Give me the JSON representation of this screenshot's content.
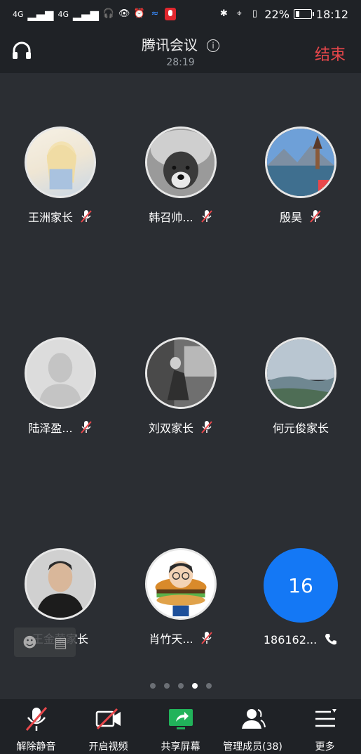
{
  "status_bar": {
    "signal1": "4G",
    "signal2": "4G",
    "battery": "22%",
    "time": "18:12"
  },
  "header": {
    "title": "腾讯会议",
    "timer": "28:19",
    "end_label": "结束"
  },
  "participants": [
    {
      "name": "王洲家长",
      "muted": true,
      "avatar": "anime-girl"
    },
    {
      "name": "韩召帅...",
      "muted": true,
      "avatar": "dog"
    },
    {
      "name": "殷昊",
      "muted": true,
      "avatar": "landscape"
    },
    {
      "name": "陆泽盈...",
      "muted": true,
      "avatar": "default-person"
    },
    {
      "name": "刘双家长",
      "muted": true,
      "avatar": "photo-bw"
    },
    {
      "name": "何元俊家长",
      "muted": false,
      "avatar": "hills"
    },
    {
      "name": "王金荣家长",
      "muted": false,
      "avatar": "man-photo"
    },
    {
      "name": "肖竹天...",
      "muted": true,
      "avatar": "cartoon-burger"
    },
    {
      "name": "186162...",
      "muted": false,
      "phone": true,
      "avatar_text": "16"
    }
  ],
  "pagination": {
    "pages": 5,
    "active": 4
  },
  "toolbar": {
    "unmute": "解除静音",
    "video": "开启视频",
    "share": "共享屏幕",
    "members": "管理成员(38)",
    "more": "更多"
  },
  "colors": {
    "end": "#e8474b",
    "accent_blue": "#1478f5",
    "share_green": "#21b35a",
    "muted_red": "#e8474b"
  }
}
